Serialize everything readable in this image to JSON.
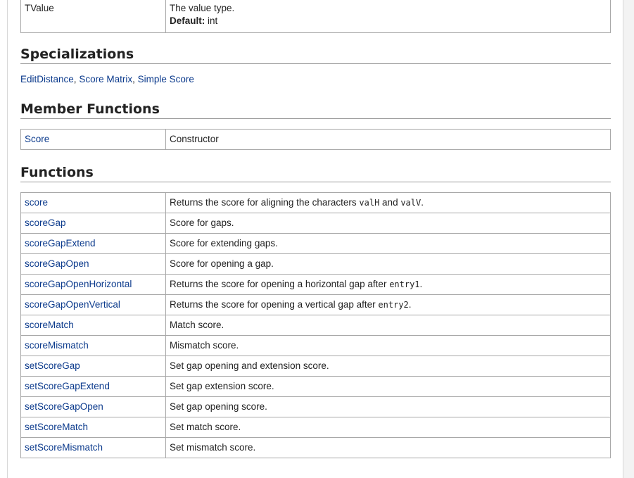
{
  "template_params": [
    {
      "name": "TValue",
      "desc": "The value type.",
      "default_label": "Default:",
      "default_value": "int"
    }
  ],
  "specializations": {
    "heading": "Specializations",
    "links": [
      "EditDistance",
      "Score Matrix",
      "Simple Score"
    ],
    "separator": ","
  },
  "member_functions": {
    "heading": "Member Functions",
    "rows": [
      {
        "name": "Score",
        "desc": "Constructor"
      }
    ]
  },
  "functions": {
    "heading": "Functions",
    "rows": [
      {
        "name": "score",
        "desc_pre": "Returns the score for aligning the characters ",
        "code1": "valH",
        "mid": " and ",
        "code2": "valV",
        "post": "."
      },
      {
        "name": "scoreGap",
        "desc": "Score for gaps."
      },
      {
        "name": "scoreGapExtend",
        "desc": "Score for extending gaps."
      },
      {
        "name": "scoreGapOpen",
        "desc": "Score for opening a gap."
      },
      {
        "name": "scoreGapOpenHorizontal",
        "desc_pre": "Returns the score for opening a horizontal gap after ",
        "code1": "entry1",
        "post": "."
      },
      {
        "name": "scoreGapOpenVertical",
        "desc_pre": "Returns the score for opening a vertical gap after ",
        "code1": "entry2",
        "post": "."
      },
      {
        "name": "scoreMatch",
        "desc": "Match score."
      },
      {
        "name": "scoreMismatch",
        "desc": "Mismatch score."
      },
      {
        "name": "setScoreGap",
        "desc": "Set gap opening and extension score."
      },
      {
        "name": "setScoreGapExtend",
        "desc": "Set gap extension score."
      },
      {
        "name": "setScoreGapOpen",
        "desc": "Set gap opening score."
      },
      {
        "name": "setScoreMatch",
        "desc": "Set match score."
      },
      {
        "name": "setScoreMismatch",
        "desc": "Set mismatch score."
      }
    ]
  },
  "colors": {
    "link": "#0b3a8c",
    "text": "#222222",
    "border": "#a8a8a8"
  }
}
